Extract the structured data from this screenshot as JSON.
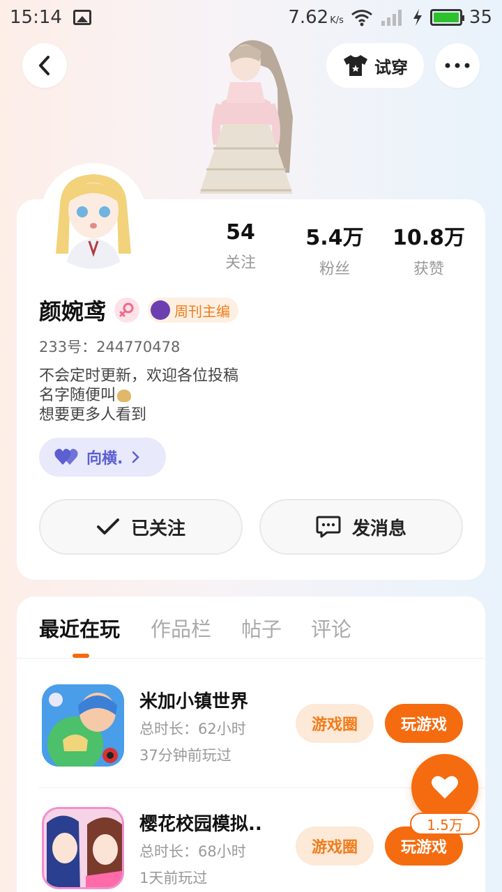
{
  "status_bar": {
    "time": "15:14",
    "net_speed": "7.62",
    "net_speed_unit": "K/s",
    "battery": "35",
    "battery_level_percent": 35
  },
  "header": {
    "tryon_label": "试穿"
  },
  "profile": {
    "stats": [
      {
        "value": "54",
        "label": "关注"
      },
      {
        "value": "5.4万",
        "label": "粉丝"
      },
      {
        "value": "10.8万",
        "label": "获赞"
      }
    ],
    "name": "颜婉鸢",
    "title_badge": "周刊主编",
    "uid": "233号：244770478",
    "bio_lines": [
      "不会定时更新，欢迎各位投稿",
      "名字随便叫",
      "想要更多人看到"
    ],
    "cp_tag": "向横.",
    "follow_label": "已关注",
    "message_label": "发消息"
  },
  "tabs": [
    {
      "label": "最近在玩",
      "active": true
    },
    {
      "label": "作品栏"
    },
    {
      "label": "帖子"
    },
    {
      "label": "评论"
    }
  ],
  "games": [
    {
      "name": "米加小镇世界",
      "duration": "总时长：62小时",
      "last_played": "37分钟前玩过",
      "circle_label": "游戏圈",
      "play_label": "玩游戏"
    },
    {
      "name": "樱花校园模拟..",
      "duration": "总时长：68小时",
      "last_played": "1天前玩过",
      "circle_label": "游戏圈",
      "play_label": "玩游戏"
    }
  ],
  "like_fab": {
    "count": "1.5万"
  },
  "colors": {
    "accent": "#f56b0f",
    "cp_purple": "#5b5fd0"
  }
}
